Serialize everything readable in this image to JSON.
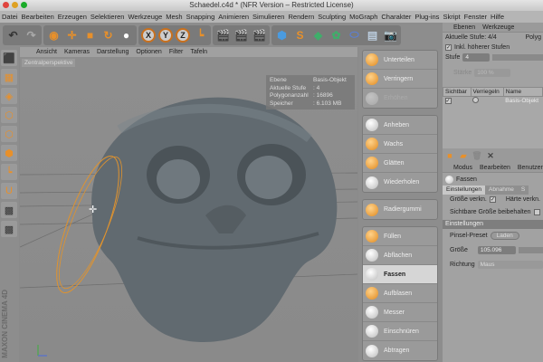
{
  "window": {
    "title": "Schaedel.c4d * (NFR Version – Restricted License)"
  },
  "menu": [
    "Datei",
    "Bearbeiten",
    "Erzeugen",
    "Selektieren",
    "Werkzeuge",
    "Mesh",
    "Snapping",
    "Animieren",
    "Simulieren",
    "Rendern",
    "Sculpting",
    "MoGraph",
    "Charakter",
    "Plug-ins",
    "Skript",
    "Fenster",
    "Hilfe"
  ],
  "axes": [
    "X",
    "Y",
    "Z"
  ],
  "viewport": {
    "menu": [
      "Ansicht",
      "Kameras",
      "Darstellung",
      "Optionen",
      "Filter",
      "Tafeln"
    ],
    "camera": "Zentralperspektive",
    "hud": [
      [
        "Ebene",
        "Basis-Objekt"
      ],
      [
        "Aktuelle Stufe",
        ": 4"
      ],
      [
        "Polygonanzahl",
        ": 16896"
      ],
      [
        "Speicher",
        ": 6.103 MB"
      ]
    ]
  },
  "brand": "MAXON CINEMA 4D",
  "palette": {
    "groups": [
      [
        "Unterteilen",
        "Verringern",
        "Erhöhen"
      ],
      [
        "Anheben",
        "Wachs",
        "Glätten",
        "Wiederholen"
      ],
      [
        "Radiergummi"
      ],
      [
        "Füllen",
        "Abflachen",
        "Fassen",
        "Aufblasen",
        "Messer",
        "Einschnüren",
        "Abtragen"
      ]
    ],
    "active": "Fassen"
  },
  "layers": {
    "tabs": [
      "Ebenen",
      "Werkzeuge"
    ],
    "current_level": "Aktuelle Stufe: 4/4",
    "poly": "Polyg",
    "incl_higher": "Inkl. höherer Stufen",
    "level_label": "Stufe",
    "level_value": "4",
    "strength_label": "Stärke",
    "strength_value": "100 %",
    "columns": [
      "Sichtbar",
      "Verriegeln",
      "Name"
    ],
    "row_name": "Basis-Objekt"
  },
  "attributes": {
    "menu": [
      "Modus",
      "Bearbeiten",
      "Benutzer"
    ],
    "tool": "Fassen",
    "tabs": [
      "Einstellungen",
      "Abnahme",
      "S"
    ],
    "size_link": "Größe verkn.",
    "hardness_link": "Härte verkn.",
    "keep_size": "Sichtbare Größe beibehalten",
    "section": "Einstellungen",
    "brush_preset": "Pinsel-Preset",
    "load": "Laden",
    "size_label": "Größe",
    "size_value": "105.096",
    "direction_label": "Richtung",
    "direction_value": "Maus"
  }
}
